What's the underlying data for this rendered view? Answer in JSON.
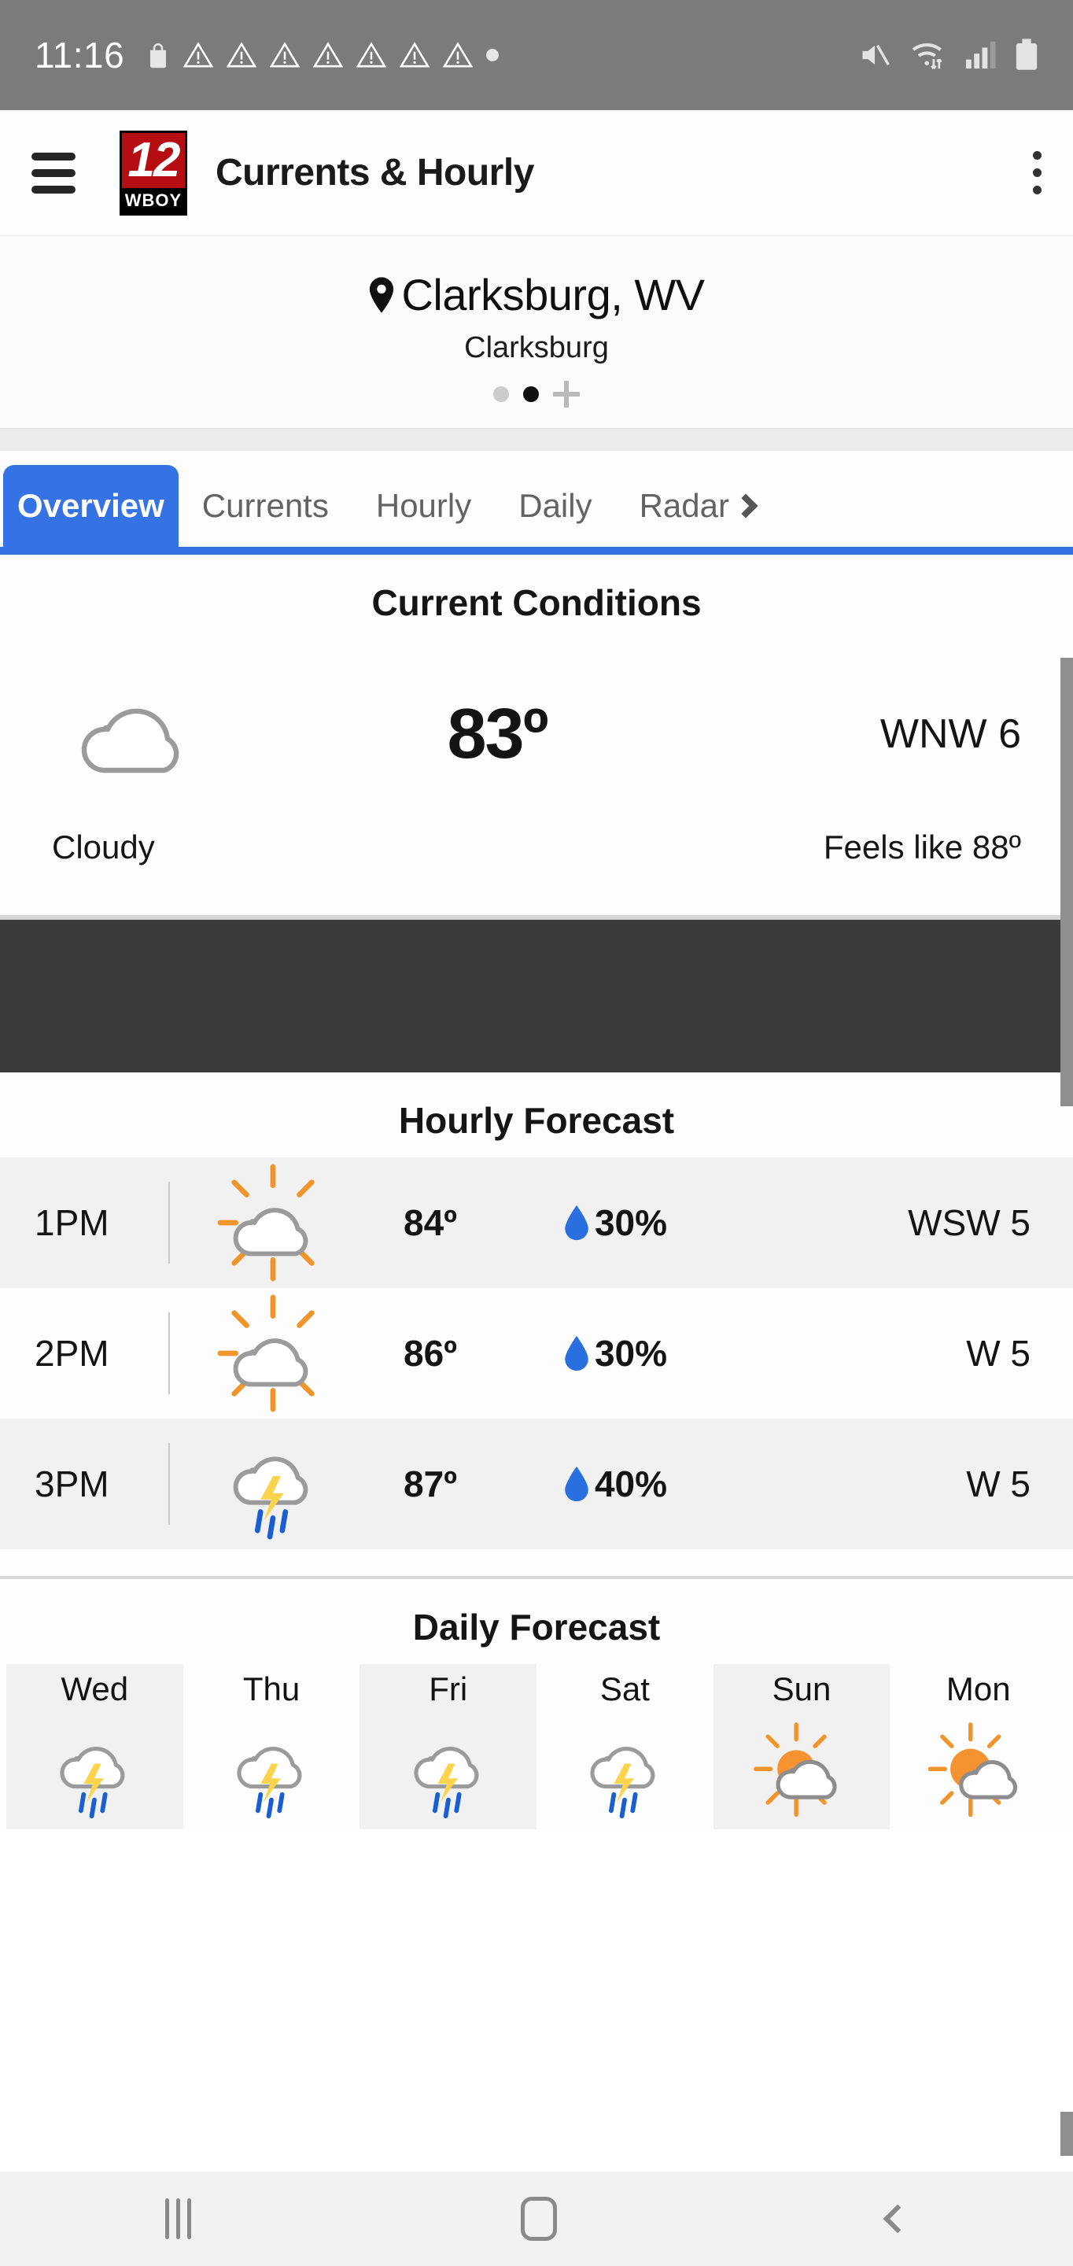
{
  "status_bar": {
    "time": "11:16",
    "left_icons": [
      "shopping-bag-icon",
      "warning-triangle-icon",
      "warning-triangle-icon",
      "warning-triangle-icon",
      "warning-triangle-icon",
      "warning-triangle-icon",
      "warning-triangle-icon",
      "warning-triangle-icon",
      "dot-indicator"
    ],
    "right_icons": [
      "volume-mute-icon",
      "wifi-icon",
      "cellular-signal-icon",
      "battery-icon"
    ],
    "background": "#7b7b7b"
  },
  "app_bar": {
    "menu_label": "menu",
    "logo_number": "12",
    "logo_callsign": "WBOY",
    "title": "Currents & Hourly",
    "overflow_label": "more options"
  },
  "location": {
    "name": "Clarksburg, WV",
    "sub": "Clarksburg",
    "pages": [
      {
        "active": false
      },
      {
        "active": true
      }
    ],
    "add_label": "+"
  },
  "tabs": {
    "active_index": 0,
    "items": [
      {
        "label": "Overview"
      },
      {
        "label": "Currents"
      },
      {
        "label": "Hourly"
      },
      {
        "label": "Daily"
      },
      {
        "label": "Radar"
      }
    ],
    "accent": "#3572e3"
  },
  "current_conditions": {
    "title": "Current Conditions",
    "icon": "cloudy-icon",
    "temperature": "83º",
    "wind": "WNW  6",
    "condition": "Cloudy",
    "feels_like": "Feels like 88º"
  },
  "ad_banner": {
    "color": "#3b3b3b"
  },
  "hourly": {
    "title": "Hourly Forecast",
    "rows": [
      {
        "time": "1PM",
        "icon": "partly-sunny-icon",
        "temp": "84º",
        "pop": "30%",
        "wind": "WSW  5"
      },
      {
        "time": "2PM",
        "icon": "partly-sunny-icon",
        "temp": "86º",
        "pop": "30%",
        "wind": "W  5"
      },
      {
        "time": "3PM",
        "icon": "thunderstorm-icon",
        "temp": "87º",
        "pop": "40%",
        "wind": "W  5"
      }
    ],
    "pop_color": "#2a6fe0"
  },
  "daily": {
    "title": "Daily Forecast",
    "days": [
      {
        "name": "Wed",
        "icon": "thunderstorm-icon"
      },
      {
        "name": "Thu",
        "icon": "thunderstorm-icon"
      },
      {
        "name": "Fri",
        "icon": "thunderstorm-icon"
      },
      {
        "name": "Sat",
        "icon": "thunderstorm-icon"
      },
      {
        "name": "Sun",
        "icon": "partly-sunny-icon"
      },
      {
        "name": "Mon",
        "icon": "partly-sunny-icon"
      }
    ]
  },
  "nav_bar": {
    "recents_label": "recents",
    "home_label": "home",
    "back_label": "back"
  }
}
